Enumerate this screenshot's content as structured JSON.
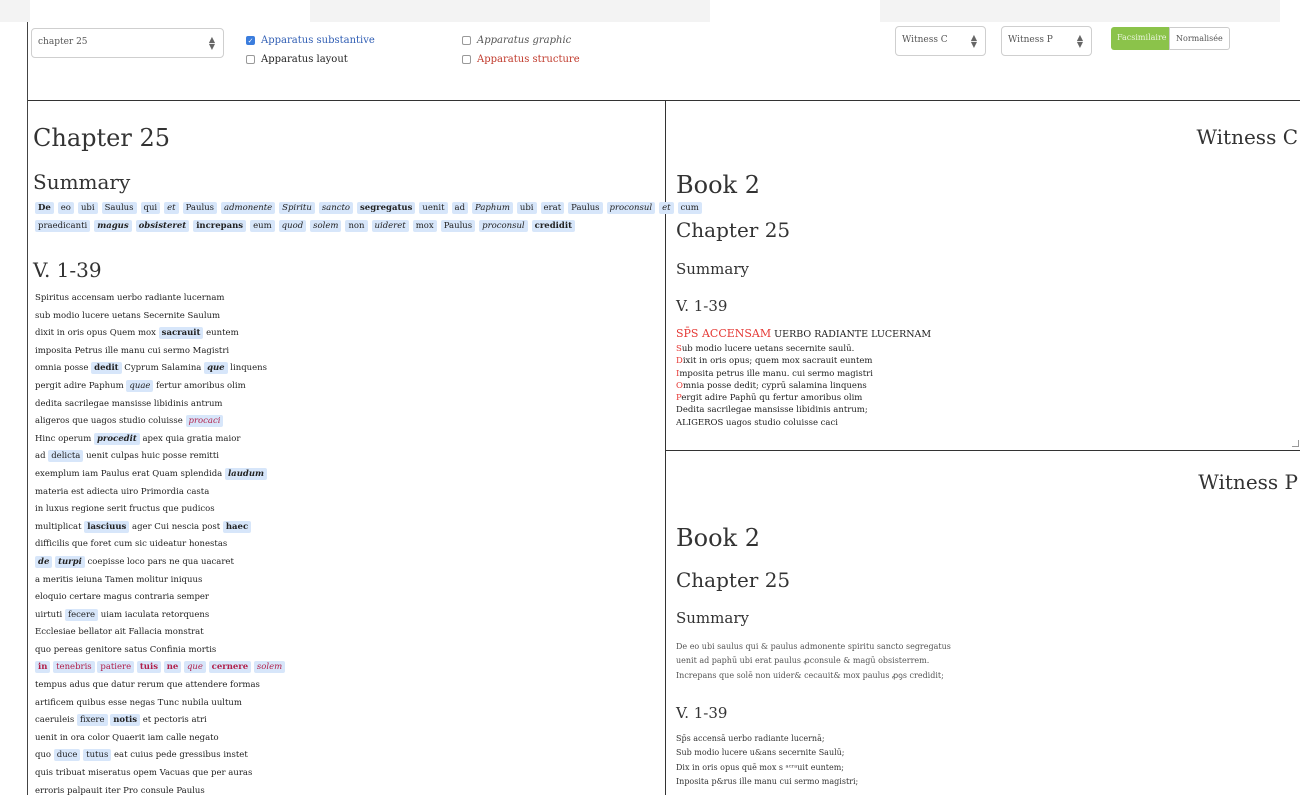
{
  "toolbar": {
    "chapter_select": "chapter 25",
    "apparatus": [
      {
        "label": "Apparatus substantive",
        "checked": true
      },
      {
        "label": "Apparatus layout",
        "checked": false
      },
      {
        "label": "Apparatus graphic",
        "checked": false
      },
      {
        "label": "Apparatus structure",
        "checked": false
      }
    ],
    "witness_c_select": "Witness C",
    "witness_p_select": "Witness P",
    "facsimilaire_label": "Facsimilaire",
    "normalisee_label": "Normalisée",
    "select_arrow": "▲▼"
  },
  "left": {
    "chapter_title": "Chapter 25",
    "summary_heading": "Summary",
    "summary_line1": [
      {
        "t": "De",
        "s": "b"
      },
      {
        "t": "eo",
        "s": ""
      },
      {
        "t": "ubi",
        "s": ""
      },
      {
        "t": "Saulus",
        "s": ""
      },
      {
        "t": "qui",
        "s": ""
      },
      {
        "t": "et",
        "s": "i"
      },
      {
        "t": "Paulus",
        "s": ""
      },
      {
        "t": "admonente",
        "s": "i"
      },
      {
        "t": "Spiritu",
        "s": "i"
      },
      {
        "t": "sancto",
        "s": "i"
      },
      {
        "t": "segregatus",
        "s": "b"
      },
      {
        "t": "uenit",
        "s": ""
      },
      {
        "t": "ad",
        "s": ""
      },
      {
        "t": "Paphum",
        "s": "i"
      },
      {
        "t": "ubi",
        "s": ""
      },
      {
        "t": "erat",
        "s": ""
      },
      {
        "t": "Paulus",
        "s": ""
      },
      {
        "t": "proconsul",
        "s": "i"
      },
      {
        "t": "et",
        "s": "i"
      },
      {
        "t": "cum",
        "s": ""
      }
    ],
    "summary_line2": [
      {
        "t": "praedicanti",
        "s": ""
      },
      {
        "t": "magus",
        "s": "bi"
      },
      {
        "t": "obsisteret",
        "s": "bi"
      },
      {
        "t": "increpans",
        "s": "b"
      },
      {
        "t": "eum",
        "s": ""
      },
      {
        "t": "quod",
        "s": "i"
      },
      {
        "t": "solem",
        "s": "i"
      },
      {
        "t": "non",
        "s": ""
      },
      {
        "t": "uideret",
        "s": "i"
      },
      {
        "t": "mox",
        "s": ""
      },
      {
        "t": "Paulus",
        "s": ""
      },
      {
        "t": "proconsul",
        "s": "i"
      },
      {
        "t": "credidit",
        "s": "b"
      }
    ],
    "verses_heading": "V. 1-39",
    "verses": [
      [
        [
          "Spiritus accensam uerbo radiante lucernam",
          ""
        ]
      ],
      [
        [
          "sub modio lucere uetans Secernite Saulum",
          ""
        ]
      ],
      [
        [
          "dixit in oris opus Quem mox ",
          ""
        ],
        [
          "sacrauit",
          "b"
        ],
        [
          " euntem",
          ""
        ]
      ],
      [
        [
          "imposita Petrus ille manu cui sermo Magistri",
          ""
        ]
      ],
      [
        [
          "omnia posse ",
          ""
        ],
        [
          "dedit",
          "b"
        ],
        [
          " Cyprum Salamina ",
          ""
        ],
        [
          "que",
          "bi"
        ],
        [
          " linquens",
          ""
        ]
      ],
      [
        [
          "pergit adire Paphum ",
          ""
        ],
        [
          "quae",
          "i"
        ],
        [
          " fertur amoribus olim",
          ""
        ]
      ],
      [
        [
          "dedita sacrilegae mansisse libidinis antrum",
          ""
        ]
      ],
      [
        [
          "aligeros que uagos studio coluisse ",
          ""
        ],
        [
          "procaci",
          "ri"
        ]
      ],
      [
        [
          "Hinc operum ",
          ""
        ],
        [
          "procedit",
          "bi"
        ],
        [
          " apex quia gratia maior",
          ""
        ]
      ],
      [
        [
          "ad ",
          ""
        ],
        [
          "delicta",
          ""
        ],
        [
          " uenit culpas huic posse remitti",
          ""
        ]
      ],
      [
        [
          "exemplum iam Paulus erat Quam splendida ",
          ""
        ],
        [
          "laudum",
          "bi"
        ]
      ],
      [
        [
          "materia est adiecta uiro Primordia casta",
          ""
        ]
      ],
      [
        [
          "in luxus regione serit fructus que pudicos",
          ""
        ]
      ],
      [
        [
          "multiplicat ",
          ""
        ],
        [
          "lasciuus",
          "b"
        ],
        [
          " ager Cui nescia post ",
          ""
        ],
        [
          "haec",
          "b"
        ]
      ],
      [
        [
          "difficilis que foret cum sic uideatur honestas",
          ""
        ]
      ],
      [
        [
          "de",
          "bi"
        ],
        [
          " ",
          ""
        ],
        [
          "turpi",
          "bi"
        ],
        [
          " coepisse loco pars ne qua uacaret",
          ""
        ]
      ],
      [
        [
          "a meritis ieiuna Tamen molitur iniquus",
          ""
        ]
      ],
      [
        [
          "eloquio certare magus contraria semper",
          ""
        ]
      ],
      [
        [
          "uirtuti ",
          ""
        ],
        [
          "fecere",
          ""
        ],
        [
          " uiam iaculata retorquens",
          ""
        ]
      ],
      [
        [
          "Ecclesiae bellator ait Fallacia monstrat",
          ""
        ]
      ],
      [
        [
          "quo pereas genitore satus Confinia mortis",
          ""
        ]
      ],
      [
        [
          "in",
          "rb"
        ],
        [
          " ",
          ""
        ],
        [
          "tenebris",
          "r"
        ],
        [
          " ",
          ""
        ],
        [
          "patiere",
          "r"
        ],
        [
          " ",
          ""
        ],
        [
          "tuis",
          "rb"
        ],
        [
          " ",
          ""
        ],
        [
          "ne",
          "rb"
        ],
        [
          " ",
          ""
        ],
        [
          "que",
          "ri"
        ],
        [
          " ",
          ""
        ],
        [
          "cernere",
          "rb"
        ],
        [
          " ",
          ""
        ],
        [
          "solem",
          "ri"
        ]
      ],
      [
        [
          "tempus adus que datur rerum que attendere formas",
          ""
        ]
      ],
      [
        [
          "artificem quibus esse negas Tunc nubila uultum",
          ""
        ]
      ],
      [
        [
          "caeruleis ",
          ""
        ],
        [
          "fixere",
          ""
        ],
        [
          " ",
          ""
        ],
        [
          "notis",
          "b"
        ],
        [
          " et pectoris atri",
          ""
        ]
      ],
      [
        [
          "uenit in ora color Quaerit iam calle negato",
          ""
        ]
      ],
      [
        [
          "quo ",
          ""
        ],
        [
          "duce",
          ""
        ],
        [
          " ",
          ""
        ],
        [
          "tutus",
          ""
        ],
        [
          " eat cuius pede gressibus instet",
          ""
        ]
      ],
      [
        [
          "quis tribuat miseratus opem Vacuas que per auras",
          ""
        ]
      ],
      [
        [
          "erroris palpauit iter Pro consule Paulus",
          ""
        ]
      ]
    ]
  },
  "witness_c": {
    "title": "Witness C",
    "book": "Book 2",
    "chapter": "Chapter 25",
    "summary": "Summary",
    "verses_heading": "V. 1-39",
    "first_line_red": "SP̄S ACCENSAM",
    "first_line_rest": " UERBO RADIANTE LUCERNAM",
    "lines": [
      [
        "S",
        "ub modio lucere uetans secernite saulū."
      ],
      [
        "D",
        "ixit in oris opus; quem mox sacrauit euntem"
      ],
      [
        "I",
        "mposita petrus ille manu. cui sermo magistri"
      ],
      [
        "O",
        "mnia posse dedit; cyprū salamina linquens"
      ],
      [
        "P",
        "ergit adire Paphū qu fertur amoribus olim"
      ],
      [
        "",
        "Dedita sacrilegae mansisse libidinis antrum;"
      ],
      [
        "",
        "ALIGEROS uagos studio coluisse caci"
      ]
    ]
  },
  "witness_p": {
    "title": "Witness P",
    "book": "Book 2",
    "chapter": "Chapter 25",
    "summary": "Summary",
    "summary_lines": [
      "De eo ubi saulus qui & paulus admonente spiritu sancto segregatus",
      "uenit ad paphū ubi erat paulus ꝓconsule & magū obsisterrem.",
      "Increpans que solē non uider&  cecauit& mox paulus ꝓꝯs credidit;"
    ],
    "verses_heading": "V. 1-39",
    "lines": [
      "Sp̄s accensā uerbo radiante lucernā;",
      "Sub modio lucere u&ans secernite Saulū;",
      "Dix in oris opus quē mox s ᵃᶜʳᵃuit euntem;",
      "Inposita p&rus ille manu cui sermo magistri;"
    ]
  }
}
